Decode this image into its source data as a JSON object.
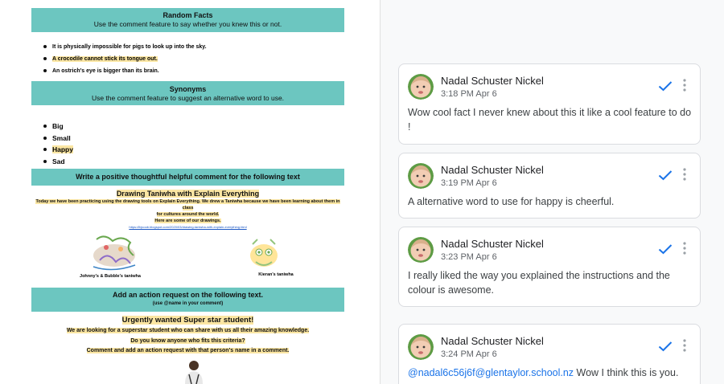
{
  "doc": {
    "random_facts": {
      "title": "Random Facts",
      "subtitle": "Use the comment feature to say whether you knew this or not.",
      "items": [
        "It is physically impossible for pigs to look up into the sky.",
        "A crocodile cannot stick its tongue out.",
        "An ostrich's eye is bigger than its brain."
      ]
    },
    "synonyms": {
      "title": "Synonyms",
      "subtitle": "Use the comment feature to suggest an alternative word to use.",
      "items": [
        "Big",
        "Small",
        "Happy",
        "Sad"
      ]
    },
    "thoughtful": {
      "title": "Write a positive thoughtful helpful comment for the following text",
      "heading": "Drawing Taniwha with Explain Everything",
      "line1": "Today we have been practicing using the drawing tools on Explain Everything. We drew a Taniwha because we have been learning about them in class",
      "line2": "for cultures around the world.",
      "line3": "Here are some of our drawings.",
      "link": "https://lbjcoob.blogspot.com/2020/03/drawing-taniwha-with-explain-everything.html",
      "caption_left": "Johnny's & Bubble's taniwha",
      "caption_right": "Kieran's taniwha"
    },
    "action": {
      "title": "Add an action request on the following text.",
      "subtitle": "(use @name in your comment)",
      "heading": "Urgently wanted Super star student!",
      "line1": "We are looking for a superstar student who can share with us all their amazing knowledge.",
      "line2": "Do you know anyone who fits this criteria?",
      "line3": "Comment and add an action request with that person's name in a comment."
    }
  },
  "comments": [
    {
      "author": "Nadal Schuster Nickel",
      "time": "3:18 PM Apr 6",
      "text": "Wow cool fact I never knew about this it like a cool feature to do !"
    },
    {
      "author": "Nadal Schuster Nickel",
      "time": "3:19 PM Apr 6",
      "text": "A alternative word to use for happy is cheerful."
    },
    {
      "author": "Nadal Schuster Nickel",
      "time": "3:23 PM Apr 6",
      "text": "I really liked the way you explained the instructions and the colour is awesome."
    },
    {
      "author": "Nadal Schuster Nickel",
      "time": "3:24 PM Apr 6",
      "mention": "@nadal6c56j6f@glentaylor.school.nz",
      "text": " Wow I think this is you."
    }
  ],
  "icons": {
    "resolve": "check-icon",
    "more": "more-vert-icon",
    "avatar": "avatar-photo"
  },
  "colors": {
    "bar": "#6cc6c0",
    "highlight": "#fbe6a3",
    "check": "#1a73e8",
    "mention": "#1a73e8"
  }
}
